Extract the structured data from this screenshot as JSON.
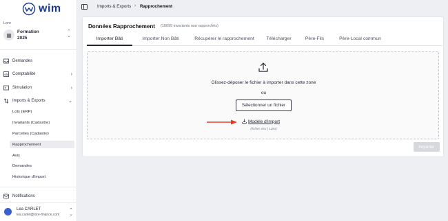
{
  "app": {
    "logo_text": "wim"
  },
  "org": {
    "label": "Lore",
    "name": "Formation",
    "year": "2025"
  },
  "sidebar": {
    "items": [
      {
        "label": "Demandes",
        "icon": "inbox-icon"
      },
      {
        "label": "Comptabilité",
        "icon": "chart-icon"
      },
      {
        "label": "Simulation",
        "icon": "simulation-icon"
      },
      {
        "label": "Imports & Exports",
        "icon": "import-export-icon"
      }
    ],
    "subitems": [
      {
        "label": "Lots (ERP)"
      },
      {
        "label": "Invariants (Cadastre)"
      },
      {
        "label": "Parcelles (Cadastre)"
      },
      {
        "label": "Rapprochement"
      },
      {
        "label": "Avis"
      },
      {
        "label": "Demandes"
      },
      {
        "label": "Historique d'import"
      }
    ],
    "notifications_label": "Notifications"
  },
  "user": {
    "name": "Lea CARLET",
    "email": "lea.carlet@lore-finance.com"
  },
  "breadcrumb": {
    "parent": "Imports & Exports",
    "current": "Rapprochement"
  },
  "card": {
    "title": "Données Rapprochement",
    "subtitle": "(10095 invariants non rapprochés)"
  },
  "tabs": [
    {
      "label": "Importer Bâti"
    },
    {
      "label": "Importer Non Bâti"
    },
    {
      "label": "Récupérer le rapprochement"
    },
    {
      "label": "Télécharger"
    },
    {
      "label": "Père-Fils"
    },
    {
      "label": "Père-Local commun"
    }
  ],
  "dropzone": {
    "instruction": "Glissez-déposer le fichier à importer dans cette zone",
    "or": "ou",
    "select_button": "Sélectionner un fichier",
    "template_link": "Modèle d'import",
    "file_info": "(fichier xlsx | 12ko)"
  },
  "import_button": "Importer",
  "colors": {
    "brand": "#1b3a8f",
    "arrow": "#e23a24",
    "active_tab": "#1f2430"
  }
}
